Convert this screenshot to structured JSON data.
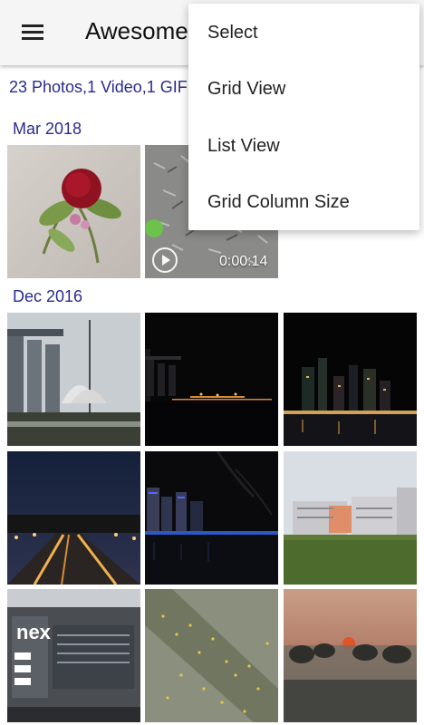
{
  "app_bar": {
    "title": "Awesome Gallery",
    "menu_icon": "hamburger-menu-icon",
    "background": "#f5f5f5"
  },
  "summary": "23 Photos,1 Video,1 GIF",
  "sections": [
    {
      "title": "Mar 2018",
      "items": [
        {
          "kind": "photo",
          "subject": "red rose boutonniere"
        },
        {
          "kind": "video",
          "subject": "shredded paper with green ball",
          "duration": "0:00:14"
        }
      ]
    },
    {
      "title": "Dec 2016",
      "items": [
        {
          "kind": "photo",
          "subject": "marina bay sands daytime"
        },
        {
          "kind": "photo",
          "subject": "marina bay night"
        },
        {
          "kind": "photo",
          "subject": "city skyline night"
        },
        {
          "kind": "photo",
          "subject": "highway at dusk"
        },
        {
          "kind": "photo",
          "subject": "buildings by water at night"
        },
        {
          "kind": "photo",
          "subject": "grass field and factory"
        },
        {
          "kind": "photo",
          "subject": "nex shopping mall"
        },
        {
          "kind": "photo",
          "subject": "yellow petals on ground"
        },
        {
          "kind": "photo",
          "subject": "sunset over trees"
        }
      ]
    }
  ],
  "overflow_menu": {
    "items": [
      "Select",
      "Grid View",
      "List View",
      "Grid Column Size"
    ]
  },
  "colors": {
    "accent": "#2a2a8f",
    "menu_background": "#ffffff"
  }
}
